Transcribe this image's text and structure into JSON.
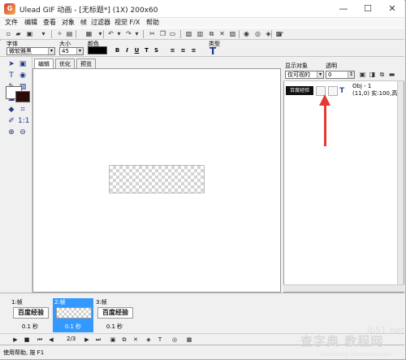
{
  "window": {
    "title": "Ulead GIF 动画 - [无标题*] (1X) 200x60",
    "controls": {
      "minimize": "—",
      "maximize": "☐",
      "close": "✕"
    }
  },
  "menu": [
    "文件",
    "编辑",
    "查看",
    "对象",
    "帧",
    "过滤器",
    "视觉 F/X",
    "帮助"
  ],
  "props": {
    "font_label": "字体",
    "font_value": "微软雅黑",
    "size_label": "大小",
    "size_value": "45",
    "color_label": "颜色",
    "color_value": "#000000",
    "type_label": "类型",
    "format_buttons": [
      "B",
      "I",
      "U",
      "T",
      "S"
    ]
  },
  "tabs": [
    "编辑",
    "优化",
    "预览"
  ],
  "object_panel": {
    "display_label": "显示对象",
    "display_value": "仅可视的",
    "opacity_label": "透明",
    "opacity_value": "0",
    "object_thumb_text": "百度经验",
    "object_info": "Obj - 1\n(11,0) 实:100,高:"
  },
  "frames": [
    {
      "label": "1:帧",
      "thumb": "百度经验",
      "delay": "0.1 秒",
      "selected": false
    },
    {
      "label": "2:帧",
      "thumb": "",
      "delay": "0.1 秒",
      "selected": true
    },
    {
      "label": "3:帧",
      "thumb": "百度经验",
      "delay": "0.1 秒",
      "selected": false
    }
  ],
  "playback": {
    "frame_count": "2/3"
  },
  "status": {
    "text": "使用帮助, 按 F1"
  },
  "watermark": {
    "main": "查字典 教程网",
    "url": "jiaocheng.chazidian.com",
    "site": "jb51.net"
  },
  "colors": {
    "accent_red": "#e53935",
    "selection_blue": "#3399ff",
    "background_color": "#2a0c08"
  }
}
